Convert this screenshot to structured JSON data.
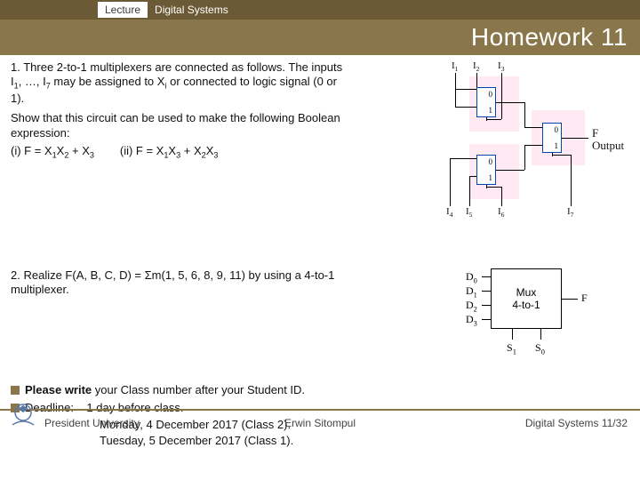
{
  "topbar": {
    "lecture": "Lecture",
    "course": "Digital Systems"
  },
  "title": "Homework 11",
  "q1": {
    "num": "1.",
    "p1a": "Three 2-to-1 multiplexers are connected as follows. The inputs I",
    "p1b": ", …, I",
    "p1c": " may be assigned to X",
    "p1d": " or connected to logic signal (0 or 1).",
    "p2": "Show that this circuit can be used to make the following Boolean expression:",
    "p3a": "(i) F = X",
    "p3b": "X",
    "p3c": " + X",
    "p3gap": "        ",
    "p3d": "(ii) F = X",
    "p3e": "X",
    "p3f": " + X",
    "p3g": "X"
  },
  "q2": {
    "num": "2.",
    "txt": "Realize F(A, B, C, D) = Σm(1, 5, 6, 8, 9, 11) by using a 4-to-1 multiplexer."
  },
  "notes": {
    "l1a": "Please write",
    "l1b": " your Class number after your Student ID.",
    "l2a": "Deadline:",
    "l2b": "1 day before class.",
    "l3": "Monday, 4 December 2017 (Class 2).",
    "l4": "Tuesday, 5 December 2017 (Class 1)."
  },
  "footer": {
    "left": "President University",
    "center": "Erwin Sitompul",
    "right": "Digital Systems 11/32"
  },
  "diag1": {
    "I1": "I",
    "I2": "I",
    "I3": "I",
    "I4": "I",
    "I5": "I",
    "I6": "I",
    "I7": "I",
    "out1": "F",
    "out2": "Output",
    "m0": "0",
    "m1": "1"
  },
  "diag2": {
    "D0": "D",
    "D1": "D",
    "D2": "D",
    "D3": "D",
    "mux1": "Mux",
    "mux2": "4-to-1",
    "F": "F",
    "S1": "S",
    "S0": "S"
  }
}
